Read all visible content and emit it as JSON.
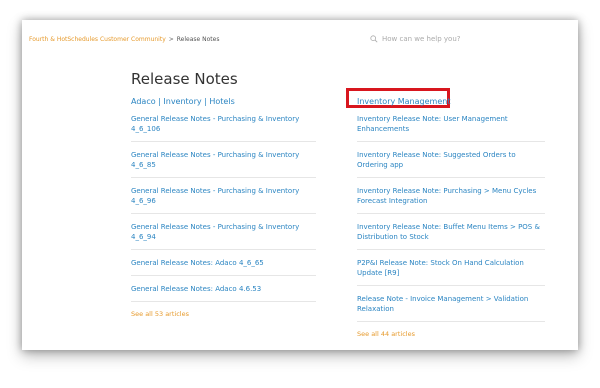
{
  "breadcrumb": {
    "community": "Fourth & HotSchedules Customer Community",
    "separator": ">",
    "current": "Release Notes"
  },
  "search": {
    "placeholder": "How can we help you?"
  },
  "page_title": "Release Notes",
  "left_section": {
    "title": "Adaco | Inventory | Hotels",
    "articles": [
      "General Release Notes - Purchasing & Inventory 4_6_106",
      "General Release Notes - Purchasing & Inventory 4_6_85",
      "General Release Notes - Purchasing & Inventory 4_6_96",
      "General Release Notes - Purchasing & Inventory 4_6_94",
      "General Release Notes: Adaco 4_6_65",
      "General Release Notes: Adaco 4.6.53"
    ],
    "see_all": "See all 53 articles"
  },
  "right_section": {
    "title": "Inventory Management",
    "articles": [
      "Inventory Release Note: User Management Enhancements",
      "Inventory Release Note: Suggested Orders to Ordering app",
      "Inventory Release Note: Purchasing > Menu Cycles Forecast Integration",
      "Inventory Release Note: Buffet Menu Items > POS & Distribution to Stock",
      "P2P&I Release Note: Stock On Hand Calculation Update [R9]",
      "Release Note - Invoice Management > Validation Relaxation"
    ],
    "see_all": "See all 44 articles"
  },
  "colors": {
    "link": "#2b85c2",
    "accent_orange": "#e69a2c",
    "highlight_red": "#d8161e"
  }
}
